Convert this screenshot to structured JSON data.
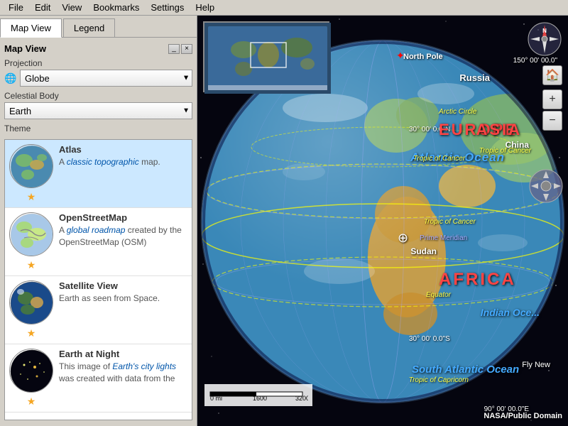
{
  "menu": {
    "items": [
      "File",
      "Edit",
      "View",
      "Bookmarks",
      "Settings",
      "Help"
    ]
  },
  "tabs": {
    "items": [
      "Map View",
      "Legend"
    ],
    "active": 0
  },
  "panel": {
    "map_view_label": "Map View",
    "projection_label": "Projection",
    "projection_value": "Globe",
    "celestial_body_label": "Celestial Body",
    "celestial_body_value": "Earth",
    "theme_label": "Theme"
  },
  "themes": [
    {
      "name": "Atlas",
      "desc_prefix": "A ",
      "desc_italic": "classic topographic",
      "desc_suffix": "\nmap.",
      "stars": 1,
      "selected": true
    },
    {
      "name": "OpenStreetMap",
      "desc_prefix": "A ",
      "desc_italic": "global roadmap",
      "desc_suffix": " created by the OpenStreetMap (OSM)",
      "stars": 1,
      "selected": false
    },
    {
      "name": "Satellite View",
      "desc_prefix": "",
      "desc_italic": "",
      "desc_suffix": "Earth as seen from Space.",
      "stars": 1,
      "selected": false
    },
    {
      "name": "Earth at Night",
      "desc_prefix": "This image of ",
      "desc_italic": "Earth's city lights",
      "desc_suffix": " was created with data from the",
      "stars": 1,
      "selected": false
    }
  ],
  "map": {
    "labels": {
      "north_pole": "North Pole",
      "russia": "Russia",
      "europe": "EUROPE",
      "asia": "ASIA",
      "china": "China",
      "africa": "AFRICA",
      "sudan": "Sudan",
      "atlantic_ocean": "Atlantic Ocean",
      "indian_ocean": "Indian Oce...",
      "south_atlantic": "South Atlantic Ocean",
      "tropic_cancer_label": "Tropic of Cancer",
      "tropic_capricorn_label": "Tropic of Capricorn",
      "arctic_circle": "Arctic Circle",
      "equator": "Equator",
      "prime_meridian": "Prime Meridian",
      "lat_30n": "30° 00' 00.0\"N",
      "lat_30s": "30° 00' 00.0\"S",
      "lon_150": "150° 00' 00.0\"E",
      "lon_90s": "90° 00' 00.0\"E",
      "coords_center": "30° 00' 0.0\"N"
    },
    "scale": {
      "label": "0 mi",
      "mid": "1600",
      "max": "3200"
    },
    "attribution": "NASA/Public Domain"
  }
}
